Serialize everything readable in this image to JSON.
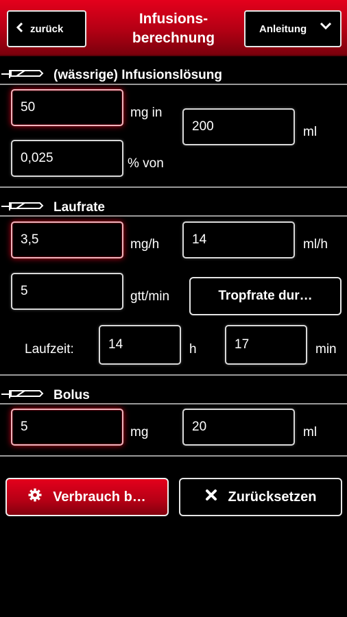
{
  "header": {
    "back_label": "zurück",
    "title_line1": "Infusions-",
    "title_line2": "berechnung",
    "guide_label": "Anleitung",
    "back_icon": "chevron-left-icon",
    "guide_icon": "chevron-down-icon"
  },
  "solution": {
    "title": "(wässrige) Infusionslösung",
    "mg_value": "50",
    "mg_in_label": "mg in",
    "percent_value": "0,025",
    "percent_label": "% von",
    "ml_value": "200",
    "ml_label": "ml"
  },
  "rate": {
    "title": "Laufrate",
    "mgh_value": "3,5",
    "mgh_label": "mg/h",
    "mlh_value": "14",
    "mlh_label": "ml/h",
    "gtt_value": "5",
    "gtt_label": "gtt/min",
    "drip_button_label": "Tropfrate dur…",
    "runtime_label": "Laufzeit:",
    "hours_value": "14",
    "hours_label": "h",
    "minutes_value": "17",
    "minutes_label": "min"
  },
  "bolus": {
    "title": "Bolus",
    "mg_value": "5",
    "mg_label": "mg",
    "ml_value": "20",
    "ml_label": "ml"
  },
  "actions": {
    "consumption_label": "Verbrauch b…",
    "consumption_icon": "gear-icon",
    "reset_label": "Zurücksetzen",
    "reset_icon": "close-icon"
  },
  "colors": {
    "accent_red": "#c4001a",
    "header_red": "#e4001c",
    "background": "#000000",
    "border_light": "#d9d9d9"
  }
}
